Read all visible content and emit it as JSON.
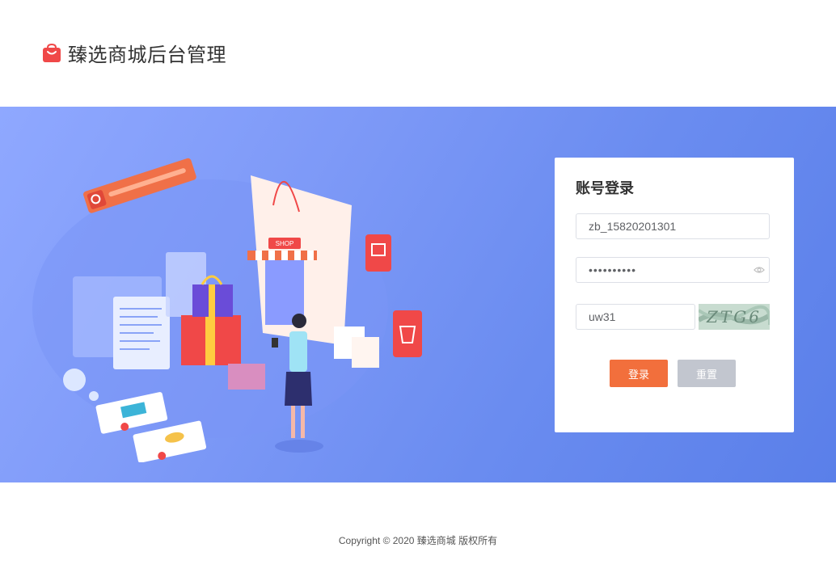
{
  "header": {
    "title": "臻选商城后台管理",
    "logo_icon": "shopping-bag-icon",
    "brand_color": "#f04848"
  },
  "banner": {
    "gradient_start": "#8fa8ff",
    "gradient_end": "#5a7fe9",
    "illustration": {
      "shop_sign": "SHOP"
    }
  },
  "login": {
    "title": "账号登录",
    "username_value": "zb_15820201301",
    "password_value": "••••••••••",
    "password_toggle_icon": "eye-icon",
    "captcha_value": "uw31",
    "captcha_image_text": "ZTG6",
    "login_button": "登录",
    "reset_button": "重置",
    "login_color": "#f26f3c",
    "reset_color": "#c2c6cf"
  },
  "footer": {
    "copyright": "Copyright © 2020 臻选商城 版权所有"
  }
}
